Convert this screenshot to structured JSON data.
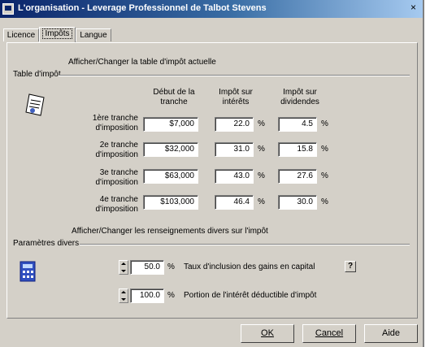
{
  "window": {
    "title": "L'organisation - Leverage Professionnel de Talbot Stevens",
    "close": "×"
  },
  "tabs": [
    {
      "label": "Licence"
    },
    {
      "label": "Impôts"
    },
    {
      "label": "Langue"
    }
  ],
  "tax_table": {
    "hint": "Afficher/Changer la table d'impôt actuelle",
    "group_label": "Table d'impôt",
    "icon": "document-icon",
    "columns": [
      "Début de la tranche",
      "Impôt sur intérêts",
      "Impôt sur dividendes"
    ],
    "rows": [
      {
        "label": "1ère tranche d'imposition",
        "start": "$7,000",
        "interest": "22.0",
        "dividend": "4.5"
      },
      {
        "label": "2e tranche d'imposition",
        "start": "$32,000",
        "interest": "31.0",
        "dividend": "15.8"
      },
      {
        "label": "3e tranche d'imposition",
        "start": "$63,000",
        "interest": "43.0",
        "dividend": "27.6"
      },
      {
        "label": "4e tranche d'imposition",
        "start": "$103,000",
        "interest": "46.4",
        "dividend": "30.0"
      }
    ],
    "unit": "%"
  },
  "misc": {
    "hint": "Afficher/Changer les renseignements divers sur l'impôt",
    "group_label": "Paramètres divers",
    "icon": "calculator-icon",
    "params": [
      {
        "value": "50.0",
        "unit": "%",
        "label": "Taux d'inclusion des gains en capital"
      },
      {
        "value": "100.0",
        "unit": "%",
        "label": "Portion de l'intérêt déductible d'impôt"
      }
    ],
    "help": "?"
  },
  "buttons": {
    "ok": "OK",
    "cancel": "Cancel",
    "help": "Aide"
  }
}
